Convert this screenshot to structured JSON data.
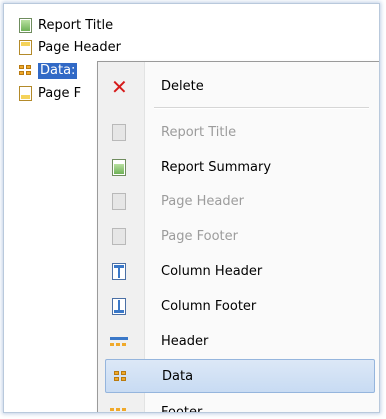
{
  "tree": {
    "items": [
      {
        "label": "Report Title",
        "icon": "report-title-band-icon"
      },
      {
        "label": "Page Header",
        "icon": "page-header-band-icon"
      },
      {
        "label": "Data:",
        "icon": "data-band-icon",
        "selected": true
      },
      {
        "label": "Page F",
        "icon": "page-footer-band-icon"
      }
    ]
  },
  "context_menu": {
    "items": [
      {
        "label": "Delete",
        "icon": "delete-x-icon",
        "enabled": true
      },
      {
        "label": "Report Title",
        "icon": "report-title-icon",
        "enabled": false
      },
      {
        "label": "Report Summary",
        "icon": "report-summary-icon",
        "enabled": true
      },
      {
        "label": "Page Header",
        "icon": "page-header-icon",
        "enabled": false
      },
      {
        "label": "Page Footer",
        "icon": "page-footer-icon",
        "enabled": false
      },
      {
        "label": "Column Header",
        "icon": "column-header-icon",
        "enabled": true
      },
      {
        "label": "Column Footer",
        "icon": "column-footer-icon",
        "enabled": true
      },
      {
        "label": "Header",
        "icon": "header-icon",
        "enabled": true
      },
      {
        "label": "Data",
        "icon": "data-icon",
        "enabled": true,
        "highlighted": true
      },
      {
        "label": "Footer",
        "icon": "footer-icon",
        "enabled": true
      }
    ]
  },
  "colors": {
    "selection": "#3169c6",
    "menu_highlight": "#c8dbf3",
    "delete_red": "#d61a1a",
    "band_yellow": "#f5d35a",
    "band_green": "#7fbf6a"
  }
}
